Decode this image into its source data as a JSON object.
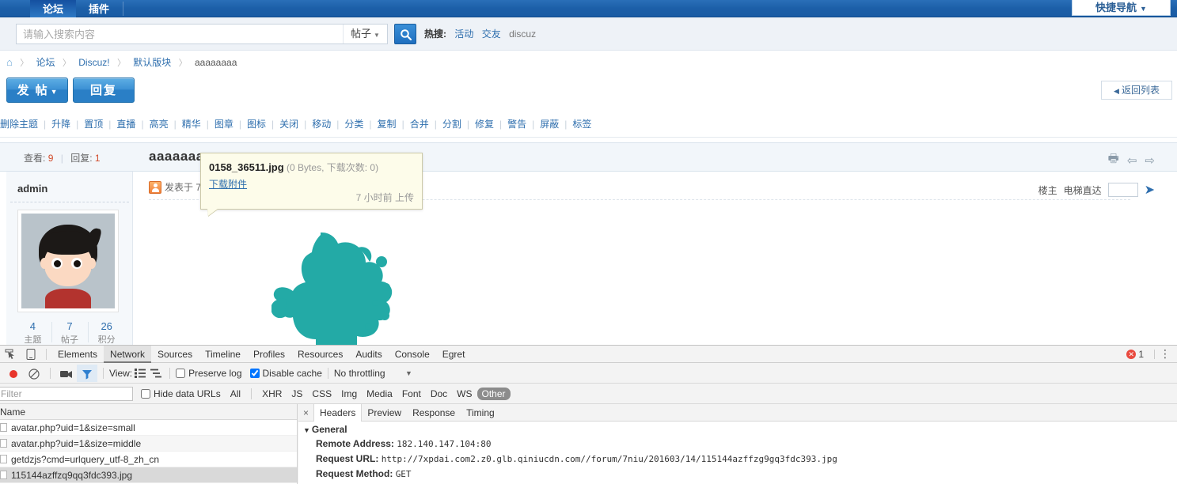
{
  "topnav": {
    "tabs": [
      {
        "label": "论坛",
        "active": true
      },
      {
        "label": "插件",
        "active": false
      }
    ],
    "quick_nav": "快捷导航",
    "quick_nav_caret": "▼"
  },
  "search": {
    "placeholder": "请输入搜索内容",
    "value": "",
    "type": "帖子",
    "type_caret": "▼",
    "button_icon": "search-icon",
    "hot_label": "热搜:",
    "hot_words": [
      "活动",
      "交友",
      "discuz"
    ]
  },
  "breadcrumb": {
    "home_icon": "home-icon",
    "separator": "〉",
    "items": [
      "论坛",
      "Discuz!",
      "默认版块",
      "aaaaaaaa"
    ]
  },
  "actions": {
    "post": "发 帖",
    "post_caret": "▼",
    "reply": "回复",
    "back_to_list": "返回列表",
    "back_arrow": "◀"
  },
  "modbar": {
    "items": [
      "删除主题",
      "升降",
      "置顶",
      "直播",
      "高亮",
      "精华",
      "图章",
      "图标",
      "关闭",
      "移动",
      "分类",
      "复制",
      "合并",
      "分割",
      "修复",
      "警告",
      "屏蔽",
      "标签"
    ],
    "separator": "|"
  },
  "thread": {
    "view_label": "查看:",
    "view_count": "9",
    "reply_label": "回复:",
    "reply_count": "1",
    "divider": "|",
    "title": "aaaaaaaa",
    "icons": [
      "print-icon",
      "prev-arrow-icon",
      "next-arrow-icon"
    ],
    "author": "admin",
    "posted_prefix": "发表于",
    "posted_time": "7",
    "floor_label": "楼主",
    "elevator_label": "电梯直达",
    "elevator_value": "",
    "go_icon": "go-arrow-icon",
    "stats": [
      {
        "value": "4",
        "label": "主题"
      },
      {
        "value": "7",
        "label": "帖子"
      },
      {
        "value": "26",
        "label": "积分"
      }
    ]
  },
  "attachment_tooltip": {
    "filename": "0158_36511.jpg",
    "meta": "(0 Bytes, 下载次数: 0)",
    "download_link": "下载附件",
    "uploaded": "7 小时前 上传"
  },
  "devtools": {
    "left_icons": [
      "inspect-icon",
      "device-toolbar-icon"
    ],
    "tabs": [
      {
        "label": "Elements",
        "active": false
      },
      {
        "label": "Network",
        "active": true
      },
      {
        "label": "Sources",
        "active": false
      },
      {
        "label": "Timeline",
        "active": false
      },
      {
        "label": "Profiles",
        "active": false
      },
      {
        "label": "Resources",
        "active": false
      },
      {
        "label": "Audits",
        "active": false
      },
      {
        "label": "Console",
        "active": false
      },
      {
        "label": "Egret",
        "active": false
      }
    ],
    "error_count": "1",
    "kebab": "⋮",
    "toolbar": {
      "record_icon": "record-icon",
      "clear_icon": "clear-icon",
      "camera_icon": "camera-icon",
      "filter_icon": "filter-icon",
      "view_label": "View:",
      "view_list_icon": "list-view-icon",
      "view_waterfall_icon": "waterfall-view-icon",
      "preserve_log": "Preserve log",
      "preserve_log_checked": false,
      "disable_cache": "Disable cache",
      "disable_cache_checked": true,
      "throttling": "No throttling",
      "throttling_caret": "▼"
    },
    "filterbar": {
      "filter_placeholder": "Filter",
      "filter_value": "",
      "hide_data_urls": "Hide data URLs",
      "hide_data_urls_checked": false,
      "types": [
        {
          "label": "All",
          "active": false
        },
        {
          "label": "XHR",
          "active": false
        },
        {
          "label": "JS",
          "active": false
        },
        {
          "label": "CSS",
          "active": false
        },
        {
          "label": "Img",
          "active": false
        },
        {
          "label": "Media",
          "active": false
        },
        {
          "label": "Font",
          "active": false
        },
        {
          "label": "Doc",
          "active": false
        },
        {
          "label": "WS",
          "active": false
        },
        {
          "label": "Other",
          "active": true
        }
      ]
    },
    "network": {
      "column_header": "Name",
      "rows": [
        {
          "name": "avatar.php?uid=1&size=small",
          "selected": false
        },
        {
          "name": "avatar.php?uid=1&size=middle",
          "selected": false
        },
        {
          "name": "getdzjs?cmd=urlquery_utf-8_zh_cn",
          "selected": false
        },
        {
          "name": "115144azffzq9qq3fdc393.jpg",
          "selected": true
        }
      ]
    },
    "detail": {
      "close": "×",
      "tabs": [
        {
          "label": "Headers",
          "active": true
        },
        {
          "label": "Preview",
          "active": false
        },
        {
          "label": "Response",
          "active": false
        },
        {
          "label": "Timing",
          "active": false
        }
      ],
      "section": "General",
      "section_tri": "▼",
      "fields": [
        {
          "key": "Remote Address:",
          "value": "182.140.147.104:80"
        },
        {
          "key": "Request URL:",
          "value": "http://7xpdai.com2.z0.glb.qiniucdn.com//forum/7niu/201603/14/115144azffzg9gq3fdc393.jpg"
        },
        {
          "key": "Request Method:",
          "value": "GET"
        }
      ]
    }
  },
  "colors": {
    "nav_blue": "#1c5fa8",
    "link_blue": "#2f6fae",
    "accent_red": "#d24a2a",
    "mascot_teal": "#23aaa6",
    "tooltip_bg": "#fdfcea"
  }
}
